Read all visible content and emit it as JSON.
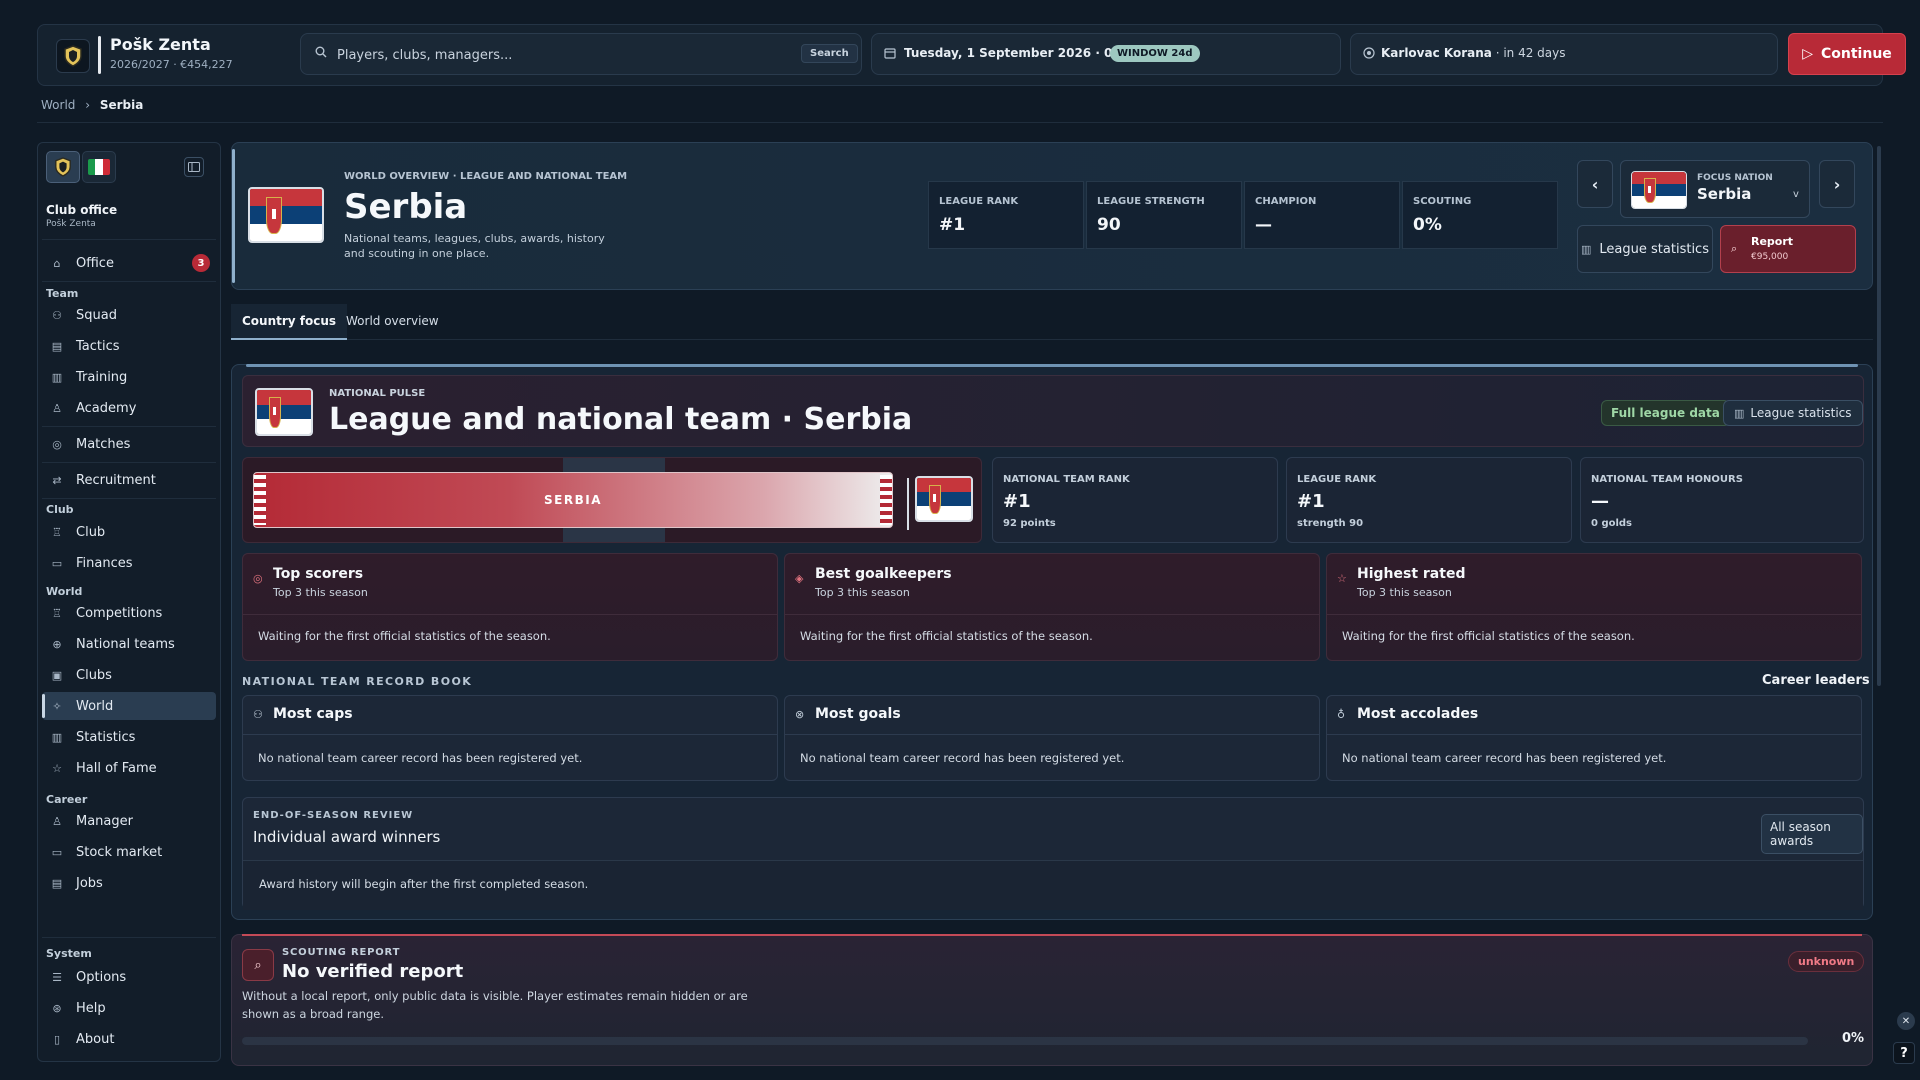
{
  "club": {
    "name": "Pošk Zenta",
    "sub": "2026/2027 · €454,227"
  },
  "search": {
    "placeholder": "Players, clubs, managers...",
    "button": "Search"
  },
  "date": {
    "text": "Tuesday, 1 September 2026 · 09:00",
    "window_badge": "WINDOW 24d"
  },
  "next_match": {
    "opponent": "Karlovac Korana",
    "when": " · in 42 days"
  },
  "continue_label": "Continue",
  "breadcrumb": {
    "root": "World",
    "sep": "›",
    "current": "Serbia"
  },
  "sidebar": {
    "header_title": "Club office",
    "header_sub": "Pošk Zenta",
    "office": {
      "label": "Office",
      "badge": "3"
    },
    "sections": {
      "team": "Team",
      "club": "Club",
      "world": "World",
      "career": "Career",
      "system": "System"
    },
    "team_items": [
      "Squad",
      "Tactics",
      "Training",
      "Academy"
    ],
    "matches": "Matches",
    "recruitment": "Recruitment",
    "club_items": [
      "Club",
      "Finances"
    ],
    "world_items": [
      "Competitions",
      "National teams",
      "Clubs",
      "World",
      "Statistics",
      "Hall of Fame"
    ],
    "career_items": [
      "Manager",
      "Stock market",
      "Jobs"
    ],
    "system_items": [
      "Options",
      "Help",
      "About"
    ]
  },
  "header": {
    "kicker": "WORLD OVERVIEW · LEAGUE AND NATIONAL TEAM",
    "title": "Serbia",
    "description": "National teams, leagues, clubs, awards, history and scouting in one place.",
    "stats": [
      {
        "label": "LEAGUE RANK",
        "value": "#1"
      },
      {
        "label": "LEAGUE STRENGTH",
        "value": "90"
      },
      {
        "label": "CHAMPION",
        "value": "—"
      },
      {
        "label": "SCOUTING",
        "value": "0%"
      }
    ],
    "focus_kicker": "FOCUS NATION",
    "focus_name": "Serbia",
    "league_stats_btn": "League statistics",
    "report_btn": "Report",
    "report_price": "€95,000"
  },
  "tabs": [
    "Country focus",
    "World overview"
  ],
  "pulse": {
    "kicker": "NATIONAL PULSE",
    "title": "League and national team · Serbia",
    "full_data_btn": "Full league data",
    "league_stats_btn": "League statistics",
    "banner_text": "SERBIA",
    "kpis": [
      {
        "label": "NATIONAL TEAM RANK",
        "value": "#1",
        "sub": "92 points"
      },
      {
        "label": "LEAGUE RANK",
        "value": "#1",
        "sub": "strength 90"
      },
      {
        "label": "NATIONAL TEAM HONOURS",
        "value": "—",
        "sub": "0 golds"
      }
    ]
  },
  "leaders": [
    {
      "title": "Top scorers",
      "sub": "Top 3 this season",
      "body": "Waiting for the first official statistics of the season."
    },
    {
      "title": "Best goalkeepers",
      "sub": "Top 3 this season",
      "body": "Waiting for the first official statistics of the season."
    },
    {
      "title": "Highest rated",
      "sub": "Top 3 this season",
      "body": "Waiting for the first official statistics of the season."
    }
  ],
  "record_book": {
    "title": "NATIONAL TEAM RECORD BOOK",
    "right_label": "Career leaders",
    "cards": [
      {
        "title": "Most caps",
        "body": "No national team career record has been registered yet."
      },
      {
        "title": "Most goals",
        "body": "No national team career record has been registered yet."
      },
      {
        "title": "Most accolades",
        "body": "No national team career record has been registered yet."
      }
    ]
  },
  "review": {
    "kicker": "END-OF-SEASON REVIEW",
    "title": "Individual award winners",
    "button": "All season awards",
    "body": "Award history will begin after the first completed season."
  },
  "scouting": {
    "kicker": "SCOUTING REPORT",
    "title": "No verified report",
    "description": "Without a local report, only public data is visible. Player estimates remain hidden or are shown as a broad range.",
    "status": "unknown",
    "progress_label": "0%",
    "progress": 0
  }
}
